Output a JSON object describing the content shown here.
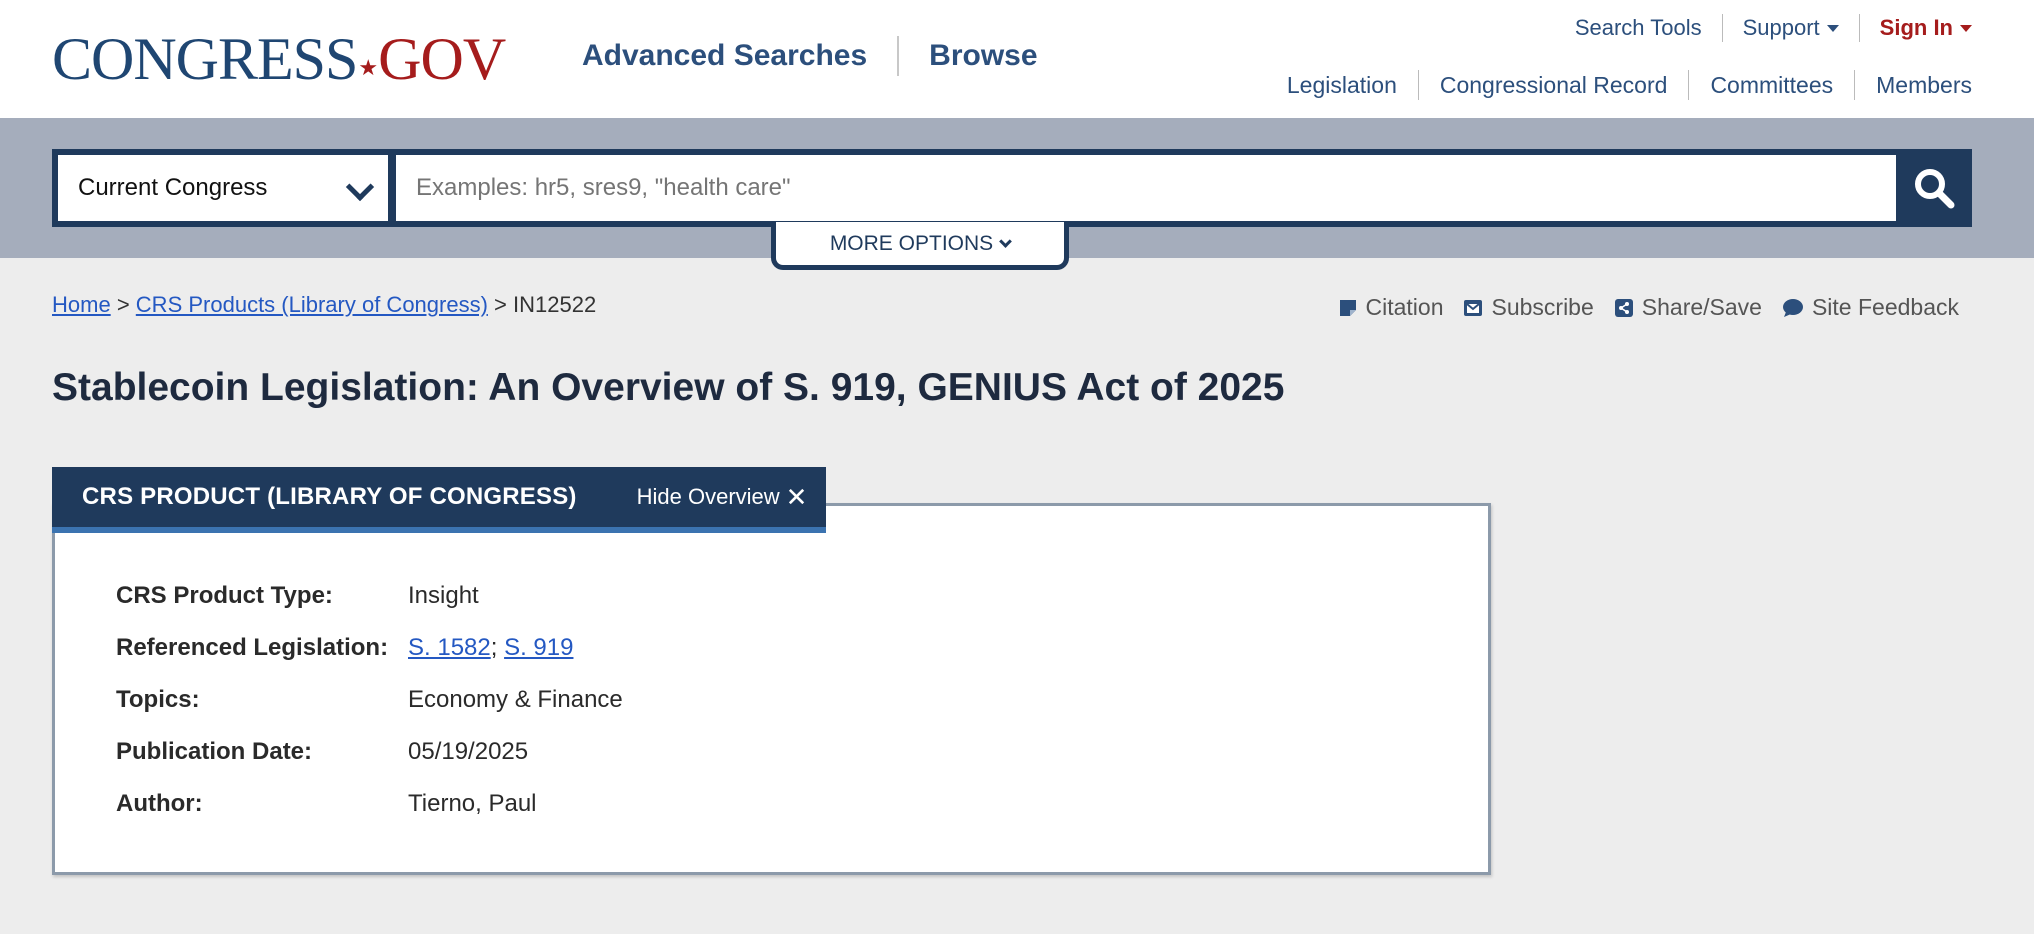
{
  "header": {
    "logo": {
      "main": "CONGRESS",
      "suffix": "GOV"
    },
    "main_nav": [
      "Advanced Searches",
      "Browse"
    ],
    "top_nav": {
      "search_tools": "Search Tools",
      "support": "Support",
      "sign_in": "Sign In"
    },
    "sub_nav": [
      "Legislation",
      "Congressional Record",
      "Committees",
      "Members"
    ]
  },
  "search": {
    "congress_select": "Current Congress",
    "placeholder": "Examples: hr5, sres9, \"health care\"",
    "more_options": "MORE OPTIONS"
  },
  "breadcrumb": {
    "home": "Home",
    "sep1": ">",
    "section": "CRS Products (Library of Congress)",
    "sep2": ">",
    "current": "IN12522"
  },
  "tools": [
    "Citation",
    "Subscribe",
    "Share/Save",
    "Site Feedback"
  ],
  "page_title": "Stablecoin Legislation: An Overview of S. 919, GENIUS Act of 2025",
  "overview": {
    "tab_title": "CRS PRODUCT (LIBRARY OF CONGRESS)",
    "hide_label": "Hide Overview",
    "rows": {
      "product_type": {
        "label": "CRS Product Type:",
        "value": "Insight"
      },
      "legislation": {
        "label": "Referenced Legislation:",
        "link1": "S. 1582",
        "separator": ";",
        "link2": "S. 919"
      },
      "topics": {
        "label": "Topics:",
        "value": "Economy & Finance"
      },
      "publication_date": {
        "label": "Publication Date:",
        "value": "05/19/2025"
      },
      "author": {
        "label": "Author:",
        "value": "Tierno, Paul"
      }
    }
  },
  "colors": {
    "brand_navy": "#1f3a5c",
    "brand_red": "#a51c1c",
    "link_blue": "#2458c2",
    "nav_blue": "#2c4f7c"
  },
  "icons": [
    "chevron-down-icon",
    "search-icon",
    "citation-icon",
    "envelope-icon",
    "share-icon",
    "speech-bubble-icon",
    "close-icon"
  ]
}
